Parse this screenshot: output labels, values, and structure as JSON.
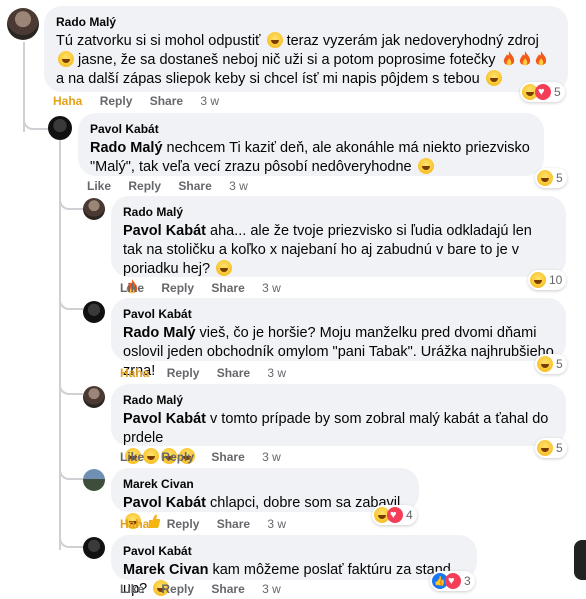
{
  "colors": {
    "bubble": "#f0f2f5",
    "haha": "#e4a11b",
    "meta": "#65676b",
    "heart": "#f33e58",
    "like": "#1877f2"
  },
  "comments": [
    {
      "author": "Rado Malý",
      "text": "Tú zatvorku si si mohol odpustiť",
      "text2": "teraz vyzerám jak nedoveryhodný zdroj",
      "text3": "jasne, že sa dostaneš neboj nič uži si a potom poprosime fotečky",
      "text4": "a na další zápas sliepok keby si chcel ísť mi napis pôjdem s tebou",
      "actions": {
        "react": "Haha",
        "reply": "Reply",
        "share": "Share",
        "time": "3 w"
      },
      "reactions": {
        "icons": [
          "haha-icon",
          "heart-icon"
        ],
        "count": "5"
      }
    },
    {
      "author": "Pavol Kabát",
      "mention": "Rado Malý",
      "text": "nechcem Ti kaziť deň, ale akonáhle má niekto priezvisko \"Malý\", tak veľa vecí zrazu pôsobí nedôveryhodne",
      "actions": {
        "react": "Like",
        "reply": "Reply",
        "share": "Share",
        "time": "3 w"
      },
      "reactions": {
        "icons": [
          "haha-icon"
        ],
        "count": "5"
      }
    },
    {
      "author": "Rado Malý",
      "mention": "Pavol Kabát",
      "text": "aha... ale že tvoje priezvisko si ľudia odkladajú len tak na stoličku a koľko x najebaní ho aj zabudnú v bare to je v poriadku hej?",
      "actions": {
        "react": "Like",
        "reply": "Reply",
        "share": "Share",
        "time": "3 w"
      },
      "reactions": {
        "icons": [
          "haha-icon"
        ],
        "count": "10"
      }
    },
    {
      "author": "Pavol Kabát",
      "mention": "Rado Malý",
      "text": "vieš, čo je horšie? Moju manželku pred dvomi dňami oslovil jeden obchodník omylom \"pani Tabak\". Urážka najhrubšieho zrna!",
      "actions": {
        "react": "Haha",
        "reply": "Reply",
        "share": "Share",
        "time": "3 w"
      },
      "reactions": {
        "icons": [
          "haha-icon"
        ],
        "count": "5"
      }
    },
    {
      "author": "Rado Malý",
      "mention": "Pavol Kabát",
      "text": "v tomto prípade by som zobral malý kabát a ťahal do prdele",
      "actions": {
        "react": "Like",
        "reply": "Reply",
        "share": "Share",
        "time": "3 w"
      },
      "reactions": {
        "icons": [
          "haha-icon"
        ],
        "count": "5"
      }
    },
    {
      "author": "Marek Civan",
      "mention": "Pavol Kabát",
      "text": "chlapci, dobre som sa zabavil",
      "actions": {
        "react": "Haha",
        "reply": "Reply",
        "share": "Share",
        "time": "3 w"
      },
      "reactions": {
        "icons": [
          "haha-icon",
          "heart-icon"
        ],
        "count": "4"
      }
    },
    {
      "author": "Pavol Kabát",
      "mention": "Marek Civan",
      "text": "kam môžeme poslať faktúru za stand up?",
      "actions": {
        "react": "Like",
        "reply": "Reply",
        "share": "Share",
        "time": "3 w"
      },
      "reactions": {
        "icons": [
          "like-icon",
          "heart-icon"
        ],
        "count": "3"
      }
    }
  ]
}
